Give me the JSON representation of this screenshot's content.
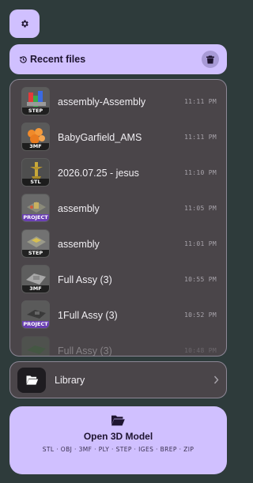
{
  "header": {
    "settings_icon": "gear-icon",
    "recent_title": "Recent files",
    "recent_icon": "history-icon",
    "clear_icon": "trash-icon"
  },
  "recent_files": [
    {
      "name": "assembly-Assembly",
      "time": "11:11 PM",
      "type": "STEP"
    },
    {
      "name": "BabyGarfield_AMS",
      "time": "11:11 PM",
      "type": "3MF"
    },
    {
      "name": "2026.07.25 - jesus",
      "time": "11:10 PM",
      "type": "STL"
    },
    {
      "name": "assembly",
      "time": "11:05 PM",
      "type": "PROJECT"
    },
    {
      "name": "assembly",
      "time": "11:01 PM",
      "type": "STEP"
    },
    {
      "name": "Full Assy (3)",
      "time": "10:55 PM",
      "type": "3MF"
    },
    {
      "name": "1Full Assy (3)",
      "time": "10:52 PM",
      "type": "PROJECT"
    },
    {
      "name": "Full Assy (3)",
      "time": "10:48 PM",
      "type": ""
    }
  ],
  "library": {
    "label": "Library",
    "icon": "folder-open-icon",
    "chevron": "chevron-right-icon"
  },
  "open_model": {
    "label": "Open 3D Model",
    "icon": "folder-open-icon",
    "formats": "STL · OBJ · 3MF · PLY · STEP · IGES · BREP · ZIP"
  },
  "colors": {
    "background": "#2e3b3b",
    "accent": "#d0c0ff",
    "panel": "#4a4549",
    "project_badge": "#6a3fb3"
  }
}
